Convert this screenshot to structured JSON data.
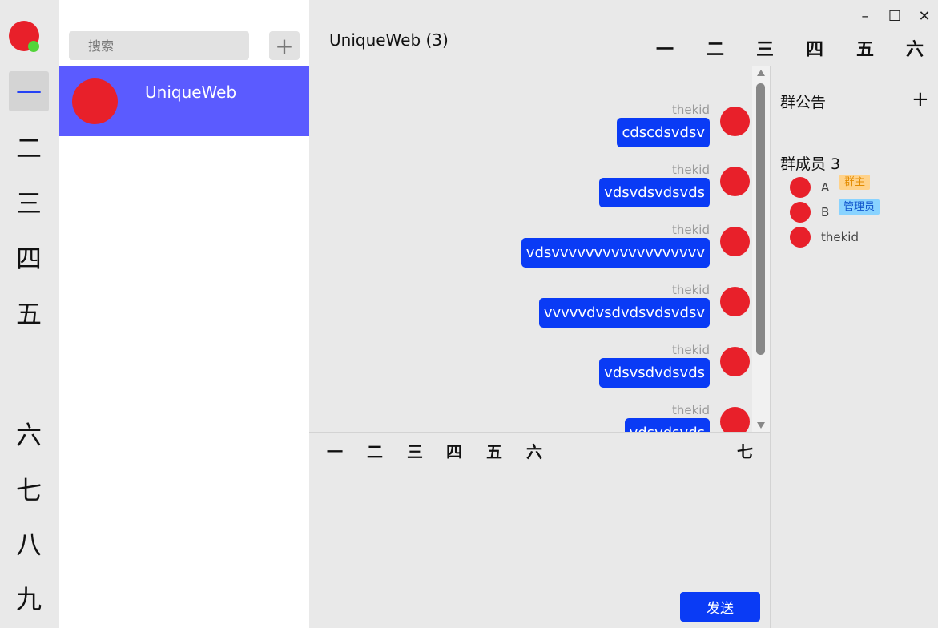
{
  "nav": {
    "items": [
      "一",
      "二",
      "三",
      "四",
      "五",
      "六",
      "七",
      "八",
      "九"
    ]
  },
  "session_list": {
    "search_placeholder": "搜索",
    "add_label": "+",
    "items": [
      {
        "name": "UniqueWeb"
      }
    ]
  },
  "chat": {
    "title": "UniqueWeb (3)",
    "window_controls": {
      "minimize": "–",
      "maximize": "☐",
      "close": "✕"
    },
    "top_tools": [
      "一",
      "二",
      "三",
      "四",
      "五",
      "六"
    ],
    "messages": [
      {
        "sender": "thekid",
        "text": "cdscdsvdsv"
      },
      {
        "sender": "thekid",
        "text": "vdsvdsvdsvds"
      },
      {
        "sender": "thekid",
        "text": "vdsvvvvvvvvvvvvvvvvvv"
      },
      {
        "sender": "thekid",
        "text": "vvvvvdvsdvdsvdsvdsv"
      },
      {
        "sender": "thekid",
        "text": "vdsvsdvdsvds"
      },
      {
        "sender": "thekid",
        "text": "vdsvdsvds"
      }
    ],
    "bottom_tools": [
      "一",
      "二",
      "三",
      "四",
      "五",
      "六",
      "七"
    ],
    "send_label": "发送"
  },
  "group": {
    "notice_title": "群公告",
    "notice_add": "+",
    "members_title": "群成员 3",
    "members": [
      {
        "name": "A",
        "badge": "群主"
      },
      {
        "name": "B",
        "badge": "管理员"
      },
      {
        "name": "thekid",
        "badge": ""
      }
    ]
  },
  "colors": {
    "accent": "#0a3bf5",
    "session_active": "#5b5bff",
    "avatar": "#e8202a",
    "online": "#52d43a"
  }
}
